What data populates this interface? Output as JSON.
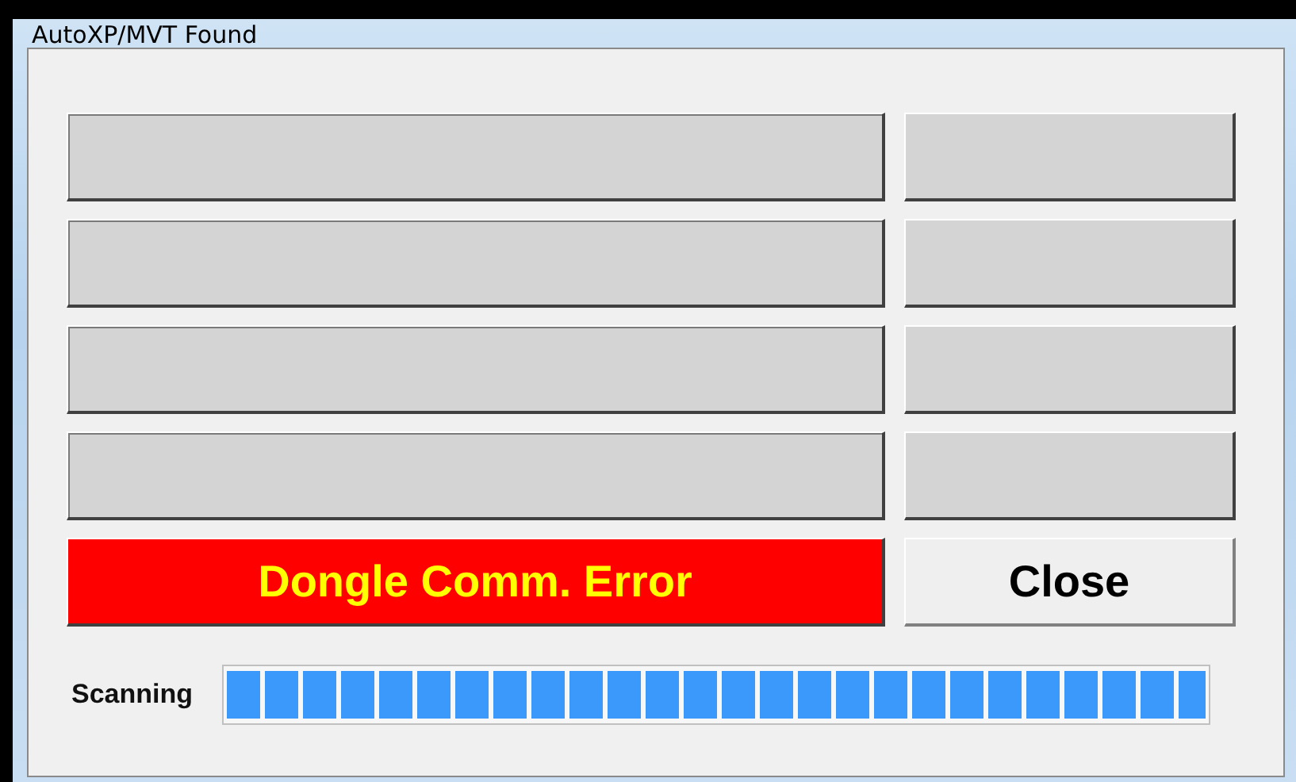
{
  "window": {
    "title": "AutoXP/MVT Found"
  },
  "status": {
    "message": "Dongle Comm. Error"
  },
  "buttons": [
    "Close"
  ],
  "progress": {
    "label": "Scanning",
    "level": 1
  }
}
